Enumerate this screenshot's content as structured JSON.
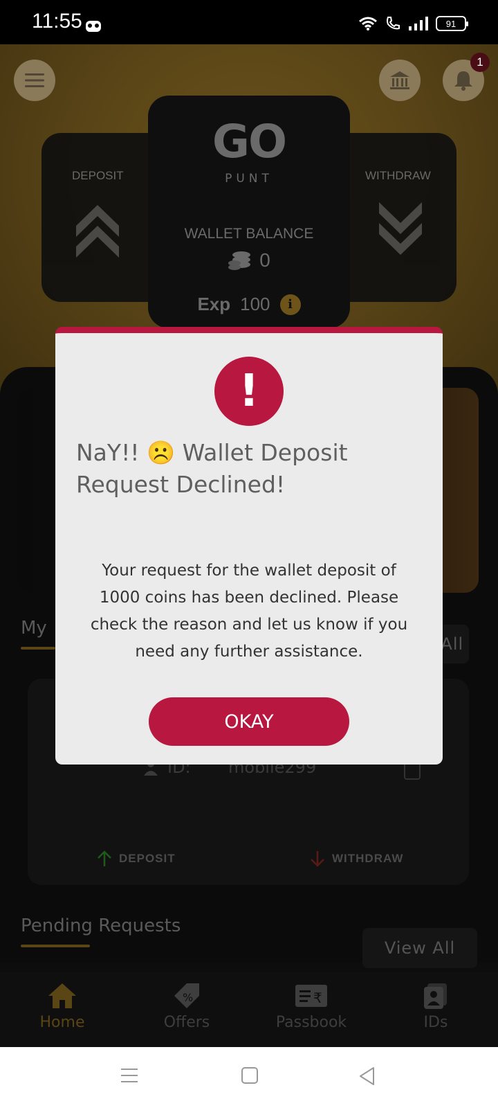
{
  "status_bar": {
    "time": "11:55",
    "battery": "91"
  },
  "header": {
    "notification_count": "1",
    "deposit_label": "DEPOSIT",
    "withdraw_label": "WITHDRAW",
    "logo_text": "GO",
    "logo_sub": "PUNT",
    "wallet_label": "WALLET BALANCE",
    "wallet_balance": "0",
    "exp_label": "Exp",
    "exp_value": "100"
  },
  "sections": {
    "my_ids_title": "My",
    "view_all": "View All",
    "pending_title": "Pending Requests",
    "pending_view_all": "View All"
  },
  "id_card": {
    "id_label": "ID:",
    "id_value": "mobile299",
    "deposit": "DEPOSIT",
    "withdraw": "WITHDRAW"
  },
  "bottom_nav": [
    {
      "label": "Home",
      "icon": "home-icon",
      "active": true
    },
    {
      "label": "Offers",
      "icon": "offers-tag-icon",
      "active": false
    },
    {
      "label": "Passbook",
      "icon": "passbook-icon",
      "active": false
    },
    {
      "label": "IDs",
      "icon": "ids-card-icon",
      "active": false
    }
  ],
  "modal": {
    "title": "NaY!! ☹️ Wallet Deposit Request Declined!",
    "message": "Your request for the wallet deposit of 1000 coins has been declined. Please check the reason and let us know if you need any further assistance.",
    "button": "OKAY"
  },
  "colors": {
    "accent": "#b8173f",
    "gold": "#e0a22a"
  }
}
